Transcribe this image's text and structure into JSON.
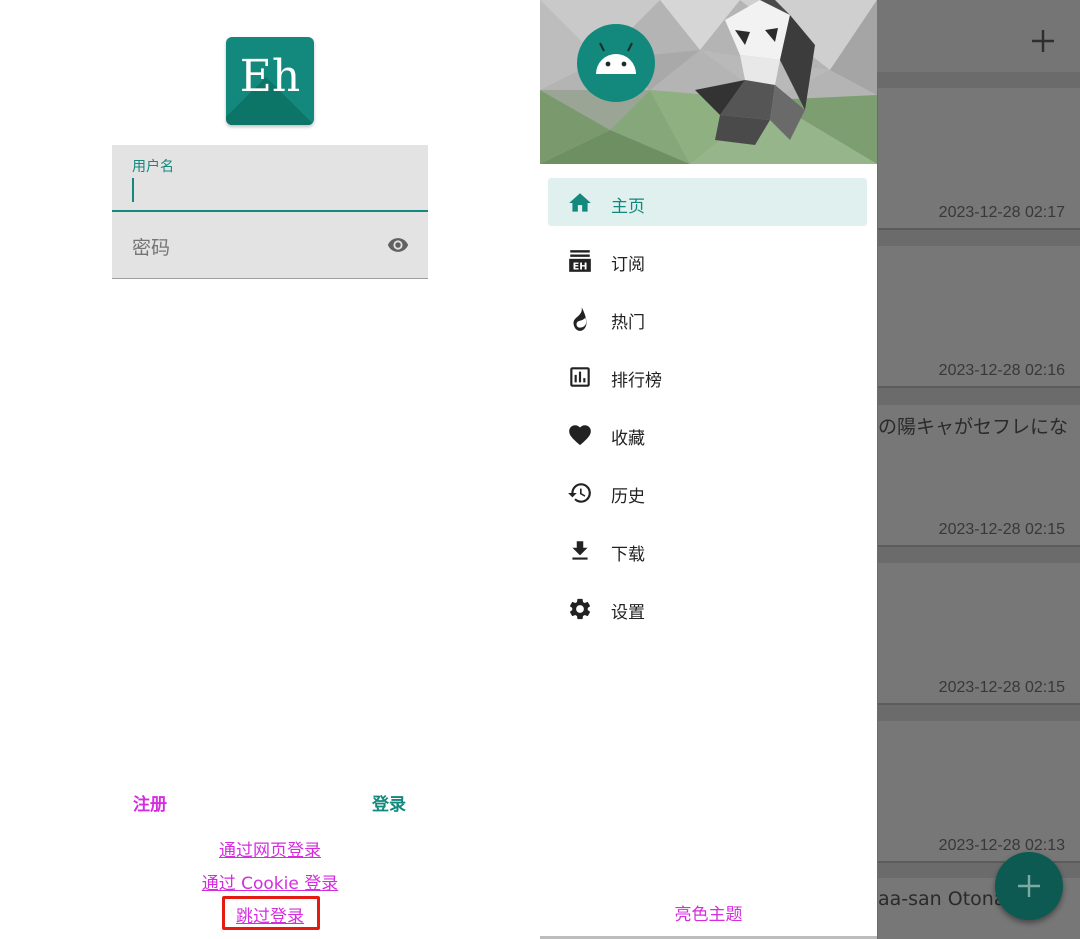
{
  "login": {
    "logo_text": "Eh",
    "username_label": "用户名",
    "password_placeholder": "密码",
    "register_label": "注册",
    "login_label": "登录",
    "web_login_link": "通过网页登录",
    "cookie_login_link": "通过 Cookie 登录",
    "skip_login_link": "跳过登录"
  },
  "drawer": {
    "nav": [
      {
        "label": "主页",
        "icon": "home-icon",
        "active": true
      },
      {
        "label": "订阅",
        "icon": "eh-subscription-icon",
        "active": false
      },
      {
        "label": "热门",
        "icon": "fire-icon",
        "active": false
      },
      {
        "label": "排行榜",
        "icon": "bar-chart-icon",
        "active": false
      },
      {
        "label": "收藏",
        "icon": "heart-icon",
        "active": false
      },
      {
        "label": "历史",
        "icon": "history-icon",
        "active": false
      },
      {
        "label": "下载",
        "icon": "download-icon",
        "active": false
      },
      {
        "label": "设置",
        "icon": "gear-icon",
        "active": false
      }
    ],
    "theme_button": "亮色主题"
  },
  "gallery": {
    "cards": [
      {
        "title": "",
        "date": "2023-12-28 02:17"
      },
      {
        "title": "",
        "date": "2023-12-28 02:16"
      },
      {
        "title": "の陽キャがセフレにな",
        "date": "2023-12-28 02:15"
      },
      {
        "title": "",
        "date": "2023-12-28 02:15"
      },
      {
        "title": "",
        "date": "2023-12-28 02:13"
      }
    ],
    "partial_title": "aa-san Otonash"
  },
  "colors": {
    "accent": "#12897c",
    "link": "#d62ce0",
    "highlight": "#e31b13"
  }
}
